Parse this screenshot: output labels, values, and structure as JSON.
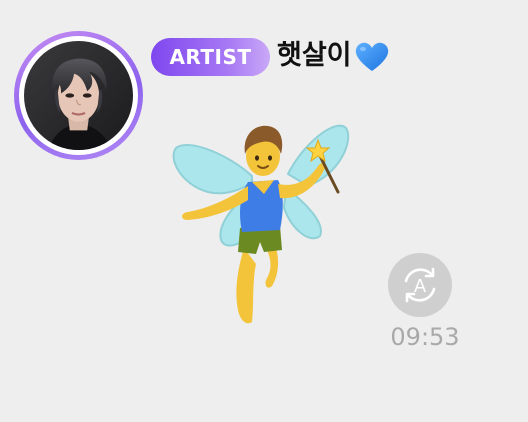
{
  "message": {
    "sender": {
      "badge": "ARTIST",
      "name": "햇살이",
      "name_suffix_icon": "blue-heart-icon",
      "avatar_icon": "artist-avatar-photo"
    },
    "content": {
      "type": "emoji-sticker",
      "icon": "man-fairy-icon"
    },
    "translate_icon": "auto-translate-icon",
    "translate_glyph": "A",
    "time": "09:53"
  },
  "colors": {
    "background": "#eeeeee",
    "badge_start": "#7e47ef",
    "badge_end": "#c9a8f7",
    "ring": "#8d63ee",
    "heart": "#2f8ff0",
    "time": "#a9a9a9",
    "translate_button": "#cfcfcf"
  }
}
